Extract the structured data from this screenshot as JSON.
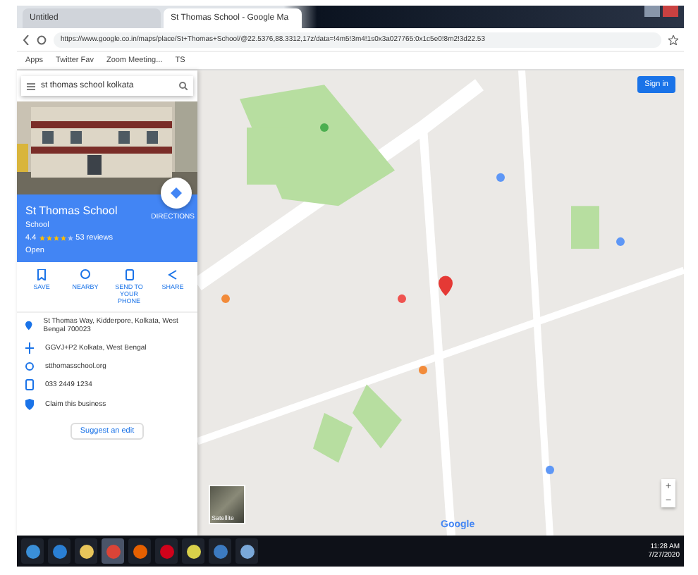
{
  "browser": {
    "tabs": [
      {
        "title": "Untitled",
        "selected": false
      },
      {
        "title": "St Thomas School - Google Ma",
        "selected": true
      }
    ],
    "url": "https://www.google.co.in/maps/place/St+Thomas+School/@22.5376,88.3312,17z/data=!4m5!3m4!1s0x3a027765:0x1c5e0!8m2!3d22.53",
    "bookmarks": [
      "Apps",
      "Twitter Fav",
      "Zoom Meeting...",
      "TS"
    ]
  },
  "panel": {
    "search": {
      "value": "st thomas school kolkata"
    },
    "place": {
      "kind": "picture",
      "name": "St Thomas School",
      "category": "School",
      "rating": "4.4",
      "stars": 4,
      "reviews": "53 reviews",
      "hours": "Open",
      "directions": "DIRECTIONS"
    },
    "actions": [
      {
        "kind": "save",
        "label": "SAVE"
      },
      {
        "kind": "nearby",
        "label": "NEARBY"
      },
      {
        "kind": "phone",
        "label": "SEND TO YOUR PHONE"
      },
      {
        "kind": "share",
        "label": "SHARE"
      }
    ],
    "info": [
      {
        "kind": "pin",
        "text": "St Thomas Way, Kidderpore, Kolkata, West Bengal 700023"
      },
      {
        "kind": "code",
        "text": "GGVJ+P2 Kolkata, West Bengal"
      },
      {
        "kind": "web",
        "text": "stthomasschool.org"
      },
      {
        "kind": "phone",
        "text": "033 2449 1234"
      },
      {
        "kind": "tag",
        "text": "Claim this business"
      }
    ],
    "suggest": "Suggest an edit"
  },
  "map": {
    "sign_in": "Sign in",
    "satellite": "Satellite",
    "logo": "Google",
    "zoom": [
      "+",
      "−"
    ]
  },
  "taskbar": {
    "apps": [
      {
        "kind": "start",
        "selected": false
      },
      {
        "kind": "ie",
        "selected": false
      },
      {
        "kind": "folder",
        "selected": false
      },
      {
        "kind": "chrome",
        "selected": true
      },
      {
        "kind": "firefox",
        "selected": false
      },
      {
        "kind": "opera",
        "selected": false
      },
      {
        "kind": "paint",
        "selected": false
      },
      {
        "kind": "media",
        "selected": false
      },
      {
        "kind": "tool",
        "selected": false
      }
    ],
    "time": "11:28 AM",
    "date": "7/27/2020"
  }
}
